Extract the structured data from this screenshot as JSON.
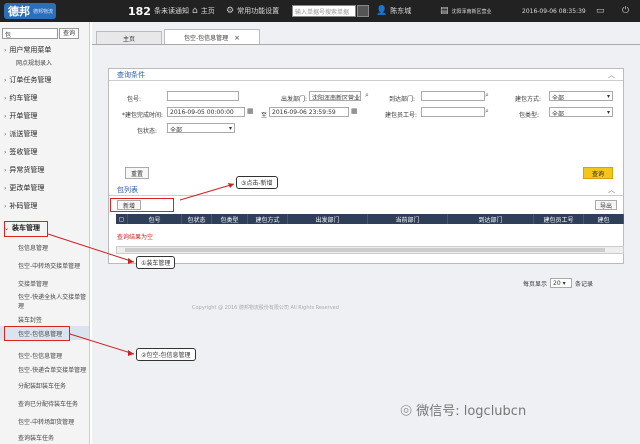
{
  "topbar": {
    "logo": "德邦",
    "logo_sub": "德邦物流",
    "notice_count": "182",
    "notice_label": "条未读通知",
    "home": "主页",
    "common_settings": "常用功能设置",
    "search_placeholder": "输入单据号搜索单据",
    "user": "陈东城",
    "org": "沈阳浑南新区营业",
    "datetime": "2016-09-06 08:35:39"
  },
  "sidebar": {
    "search_value": "包",
    "search_button": "查询",
    "menus": [
      "用户常用菜单",
      "网点规划录入",
      "订单任务管理",
      "约车管理",
      "开单管理",
      "派送管理",
      "签收管理",
      "异常货管理",
      "更改单管理",
      "补码管理",
      "装车管理"
    ],
    "subitems": [
      "包信息管理",
      "包空-中转场交接单管理",
      "交接单管理",
      "包空-快递全执人交接单管理",
      "装车封签",
      "包空-包信息管理",
      "包空-包信息管理",
      "包空-快递合单交接单管理",
      "分配装卸装车任务",
      "查询已分配待装车任务",
      "包空-中转场卸货管理",
      "查询装车任务"
    ]
  },
  "tabs": [
    "主页",
    "包空-包信息管理"
  ],
  "query": {
    "title": "查询条件",
    "labels": {
      "pkg_no": "包号:",
      "origin": "出发部门:",
      "dest": "到达部门:",
      "build_method": "建包方式:",
      "time": "*建包完成时间:",
      "to": "至",
      "builder": "建包员工号:",
      "pkg_type": "包类型:",
      "status": "包状态:"
    },
    "values": {
      "origin": "沈阳浑南新区营业部",
      "build_method": "全部",
      "time_from": "2016-09-05 00:00:00",
      "time_to": "2016-09-06 23:59:59",
      "pkg_type": "全部",
      "status": "全部"
    },
    "reset": "重置",
    "search": "查询"
  },
  "list": {
    "title": "包列表",
    "add": "新增",
    "export": "导出",
    "columns": [
      "包号",
      "包状态",
      "包类型",
      "建包方式",
      "出发部门",
      "当前部门",
      "到达部门",
      "建包员工号",
      "建包"
    ],
    "empty": "查询结果为空",
    "page_size_label": "每页显示",
    "page_size": "20",
    "page_suffix": "条记录"
  },
  "annotations": {
    "click_add": "③点击-新增",
    "load_mgmt": "①装车管理",
    "pkg_info_mgmt": "②包空-包信息管理"
  },
  "footer": "Copyright @ 2016 德邦物流股份有限公司 All Rights Reserved",
  "watermark": "微信号: logclubcn"
}
